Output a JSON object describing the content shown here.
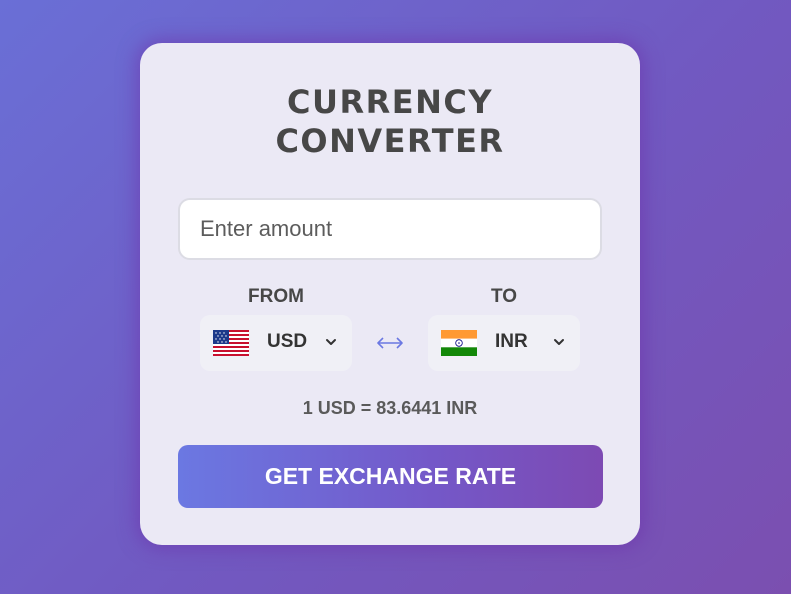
{
  "title_line1": "CURRENCY",
  "title_line2": "CONVERTER",
  "amount": {
    "placeholder": "Enter amount",
    "value": ""
  },
  "from": {
    "label": "FROM",
    "currency": "USD",
    "flag_icon": "us-flag-icon"
  },
  "to": {
    "label": "TO",
    "currency": "INR",
    "flag_icon": "india-flag-icon"
  },
  "swap_icon": "swap-arrows-icon",
  "rate_text": "1 USD = 83.6441 INR",
  "button_label": "GET EXCHANGE RATE",
  "colors": {
    "accent": "#6b78e2",
    "accent_end": "#7d4ab3",
    "card_bg": "#ebe9f5",
    "text": "#474747"
  }
}
